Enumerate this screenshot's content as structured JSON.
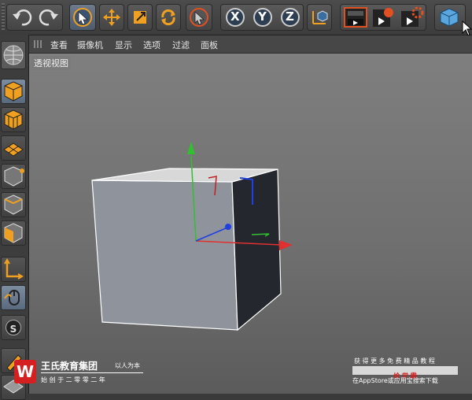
{
  "viewport": {
    "menu": [
      "查看",
      "摄像机",
      "显示",
      "选项",
      "过滤",
      "面板"
    ],
    "label": "透视视图"
  },
  "toolbar": {
    "tools": [
      "undo-icon",
      "redo-icon",
      "select-icon",
      "move-icon",
      "scale-icon",
      "rotate-icon",
      "live-select-icon",
      "x-axis-icon",
      "y-axis-icon",
      "z-axis-icon",
      "world-coordinate-icon",
      "render-view-icon",
      "render-to-picture-viewer-icon",
      "render-settings-icon",
      "cube-object-icon"
    ],
    "axis_x": "X",
    "axis_y": "Y",
    "axis_z": "Z"
  },
  "palette": {
    "tools": [
      "model-mode-icon",
      "texture-mode-icon",
      "workplane-mode-icon",
      "point-mode-icon",
      "edge-mode-icon",
      "polygon-mode-icon",
      "axis-mode-icon",
      "tweak-mode-icon",
      "snap-icon",
      "sculpt-icon"
    ],
    "snap_label": "S"
  },
  "watermark": {
    "logo_letter": "W",
    "company": "王氏教育集团",
    "slogan": "以人为本",
    "since": "始 创 于 二 零 零 二 年",
    "tagline": "获 得 更 多 免 费 精 品 教 程",
    "app_name": "绘 学 霸",
    "download": "在AppStore或应用宝搜索下载"
  },
  "colors": {
    "accent": "#f0a020",
    "axis_x": "#e03030",
    "axis_y": "#30c030",
    "axis_z": "#2040e0"
  }
}
